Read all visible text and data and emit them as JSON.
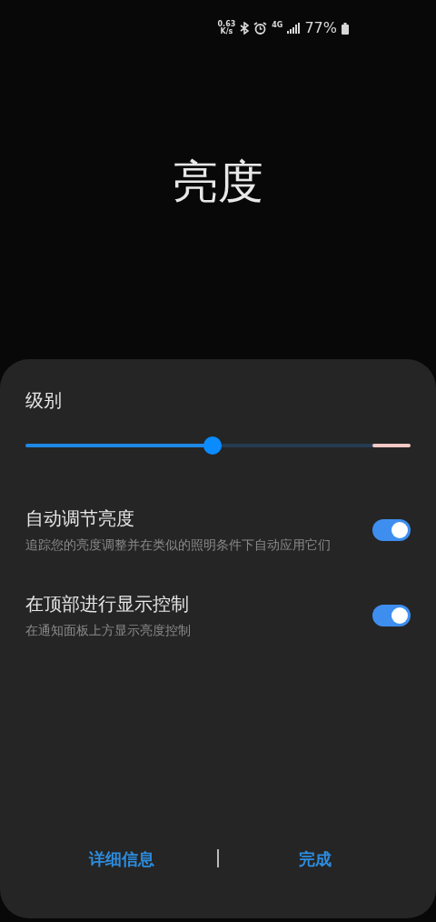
{
  "status_bar": {
    "speed": "0.63",
    "speed_unit": "K/s",
    "network": "4G",
    "battery": "77%"
  },
  "title": "亮度",
  "panel": {
    "level_label": "级别",
    "brightness": {
      "level": 0.486
    },
    "settings": [
      {
        "title": "自动调节亮度",
        "description": "追踪您的亮度调整并在类似的照明条件下自动应用它们",
        "on": true
      },
      {
        "title": "在顶部进行显示控制",
        "description": "在通知面板上方显示亮度控制",
        "on": true
      }
    ],
    "buttons": [
      "详细信息",
      "完成"
    ]
  }
}
